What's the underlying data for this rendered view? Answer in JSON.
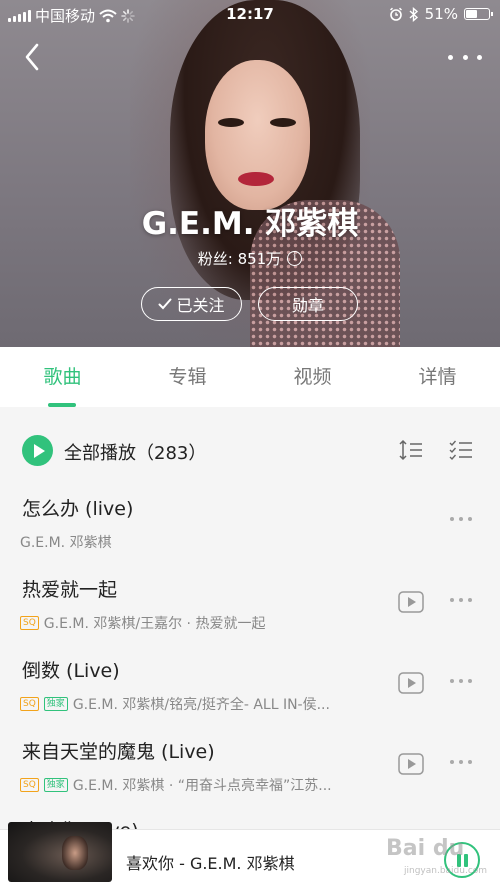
{
  "status_bar": {
    "carrier": "中国移动",
    "time": "12:17",
    "battery": "51%"
  },
  "artist": {
    "name": "G.E.M. 邓紫棋",
    "fans": "粉丝: 851万",
    "follow_label": "已关注",
    "badge_label": "勋章"
  },
  "tabs": [
    "歌曲",
    "专辑",
    "视频",
    "详情"
  ],
  "active_tab": "歌曲",
  "play_all": {
    "label": "全部播放（283）"
  },
  "songs": [
    {
      "title": "怎么办 (live)",
      "sq": false,
      "exclusive": false,
      "subtitle": "G.E.M. 邓紫棋",
      "has_mv": false
    },
    {
      "title": "热爱就一起",
      "sq": true,
      "exclusive": false,
      "subtitle": "G.E.M. 邓紫棋/王嘉尔 · 热爱就一起",
      "has_mv": true
    },
    {
      "title": "倒数 (Live)",
      "sq": true,
      "exclusive": true,
      "subtitle": "G.E.M. 邓紫棋/铭亮/挺齐全- ALL IN-侯...",
      "has_mv": true
    },
    {
      "title": "来自天堂的魔鬼 (Live)",
      "sq": true,
      "exclusive": true,
      "subtitle": "G.E.M. 邓紫棋 · “用奋斗点亮幸福”江苏...",
      "has_mv": true
    },
    {
      "title": "喜欢你 (Live)",
      "sq": false,
      "exclusive": false,
      "subtitle": "",
      "has_mv": false
    }
  ],
  "tags": {
    "sq": "SQ",
    "exclusive": "独家"
  },
  "mini_player": {
    "title": "喜欢你 - G.E.M. 邓紫棋"
  },
  "watermark": {
    "main": "Bai du",
    "sub": "jingyan.baidu.com"
  },
  "colors": {
    "accent": "#31c27c",
    "sq": "#f2a31b"
  },
  "icons": [
    "back-icon",
    "more-icon",
    "info-icon",
    "check-icon",
    "play-icon",
    "sort-icon",
    "multi-select-icon",
    "mv-icon",
    "pause-icon"
  ]
}
